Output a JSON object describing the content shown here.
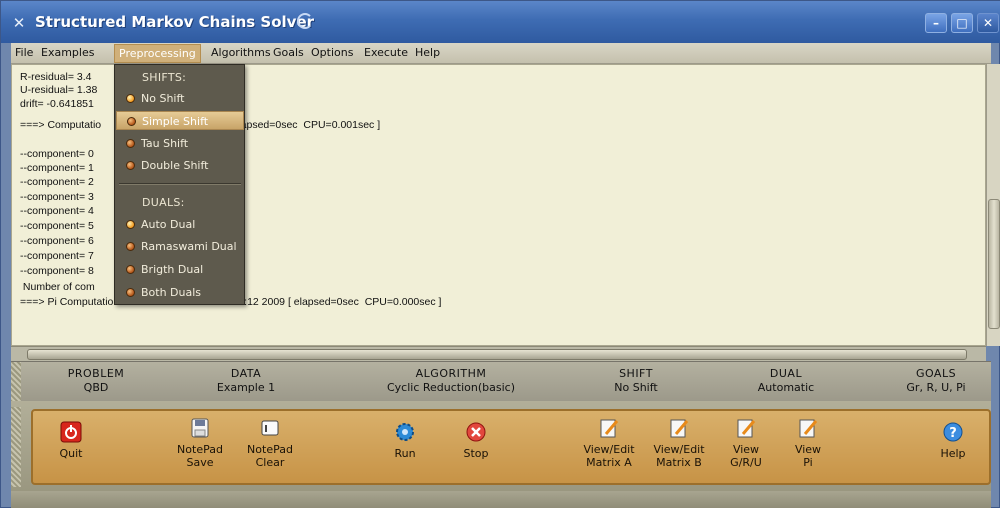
{
  "window": {
    "title": "Structured Markov Chains Solver"
  },
  "menu": [
    {
      "label": "File"
    },
    {
      "label": "Examples"
    },
    {
      "label": "Preprocessing"
    },
    {
      "label": "Algorithms"
    },
    {
      "label": "Goals"
    },
    {
      "label": "Options"
    },
    {
      "label": "Execute"
    },
    {
      "label": "Help"
    }
  ],
  "console": {
    "lines": [
      "R-residual= 3.4",
      "U-residual= 1.38",
      "drift= -0.641851",
      "===> Computatio                   15:22:12 2009 [ elapsed=0sec  CPU=0.001sec ]",
      "",
      "--component= 0                   9548265101503381",
      "--component= 1                   9978377064695432",
      "--component= 2                   9998989163964667",
      "--component= 3                   9999952231944854",
      "--component= 4                   9999997754477516",
      "--component= 5                   9999999894165624",
      "--component= 6                   999999999501838",
      "--component= 7                   9999999999765361",
      "--component= 8                   9999999999988951",
      " Number of com                   nents of pi=  8",
      "===> Pi Computation Ends  at  Tue Jul 14 15:22:12 2009 [ elapsed=0sec  CPU=0.000sec ]"
    ]
  },
  "dropdown": {
    "shifts_header": "SHIFTS:",
    "duals_header": "DUALS:",
    "shift_items": [
      {
        "label": "No Shift",
        "on": true
      },
      {
        "label": "Simple Shift",
        "on": false,
        "highlight": true
      },
      {
        "label": "Tau Shift",
        "on": false
      },
      {
        "label": "Double Shift",
        "on": false
      }
    ],
    "dual_items": [
      {
        "label": "Auto Dual",
        "on": true
      },
      {
        "label": "Ramaswami Dual",
        "on": false
      },
      {
        "label": "Brigth Dual",
        "on": false
      },
      {
        "label": "Both Duals",
        "on": false
      }
    ]
  },
  "status": {
    "problem": {
      "caption": "PROBLEM",
      "value": "QBD"
    },
    "data": {
      "caption": "DATA",
      "value": "Example 1"
    },
    "algorithm": {
      "caption": "ALGORITHM",
      "value": "Cyclic Reduction(basic)"
    },
    "shift": {
      "caption": "SHIFT",
      "value": "No Shift"
    },
    "dual": {
      "caption": "DUAL",
      "value": "Automatic"
    },
    "goals": {
      "caption": "GOALS",
      "value": "Gr, R, U, Pi"
    }
  },
  "toolbar": {
    "quit": "Quit",
    "notepad_save": [
      "NotePad",
      "Save"
    ],
    "notepad_clear": [
      "NotePad",
      "Clear"
    ],
    "run": "Run",
    "stop": "Stop",
    "view_a": [
      "View/Edit",
      "Matrix A"
    ],
    "view_b": [
      "View/Edit",
      "Matrix B"
    ],
    "view_gru": [
      "View",
      "G/R/U"
    ],
    "view_pi": [
      "View",
      "Pi"
    ],
    "help": "Help"
  },
  "colors": {
    "accent": "#d0b07a",
    "console_bg": "#f1efd7",
    "title_blue": "#3e6cb3"
  }
}
